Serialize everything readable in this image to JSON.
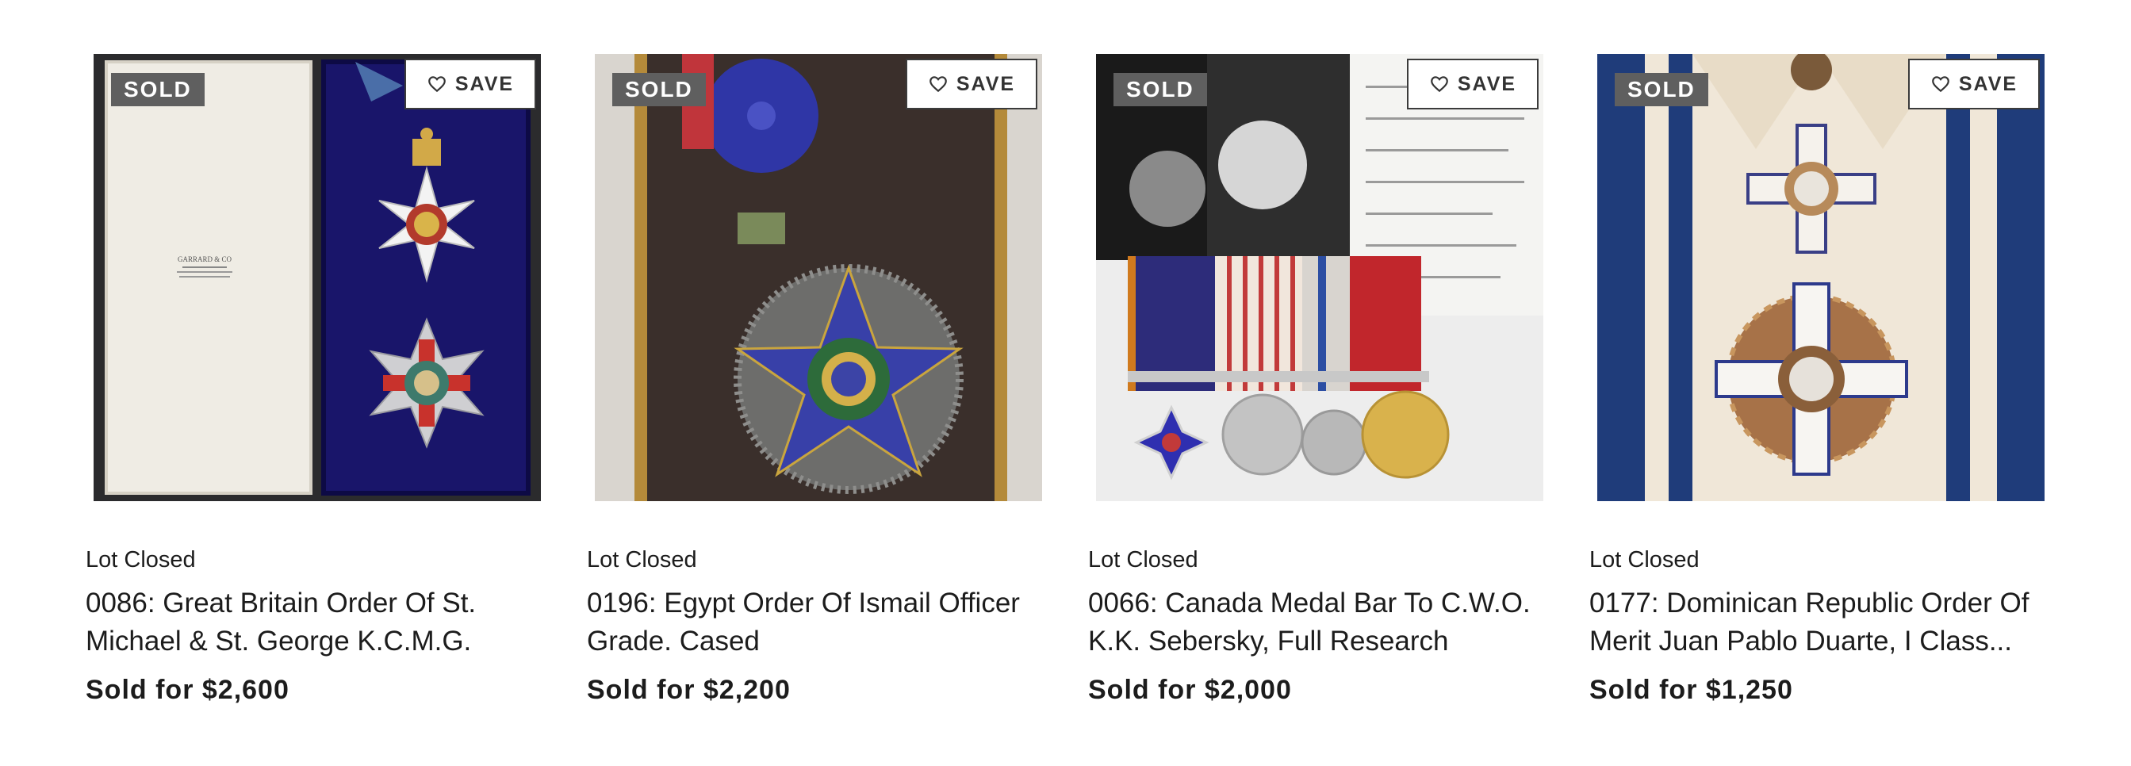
{
  "lots": [
    {
      "status": "Lot Closed",
      "title": "0086: Great Britain Order Of St. Michael & St. George K.C.M.G.",
      "price": "Sold for $2,600",
      "badge": "SOLD",
      "save_label": "SAVE"
    },
    {
      "status": "Lot Closed",
      "title": "0196: Egypt Order Of Ismail Officer Grade. Cased",
      "price": "Sold for $2,200",
      "badge": "SOLD",
      "save_label": "SAVE"
    },
    {
      "status": "Lot Closed",
      "title": "0066: Canada Medal Bar To C.W.O. K.K. Sebersky, Full Research",
      "price": "Sold for $2,000",
      "badge": "SOLD",
      "save_label": "SAVE"
    },
    {
      "status": "Lot Closed",
      "title": "0177: Dominican Republic Order Of Merit Juan Pablo Duarte, I Class...",
      "price": "Sold for $1,250",
      "badge": "SOLD",
      "save_label": "SAVE"
    }
  ],
  "icons": {
    "save": "heart-outline-icon"
  },
  "colors": {
    "sold_badge": "#5f5f5f",
    "text": "#1c1c1c",
    "save_border": "#3b3b3b"
  }
}
